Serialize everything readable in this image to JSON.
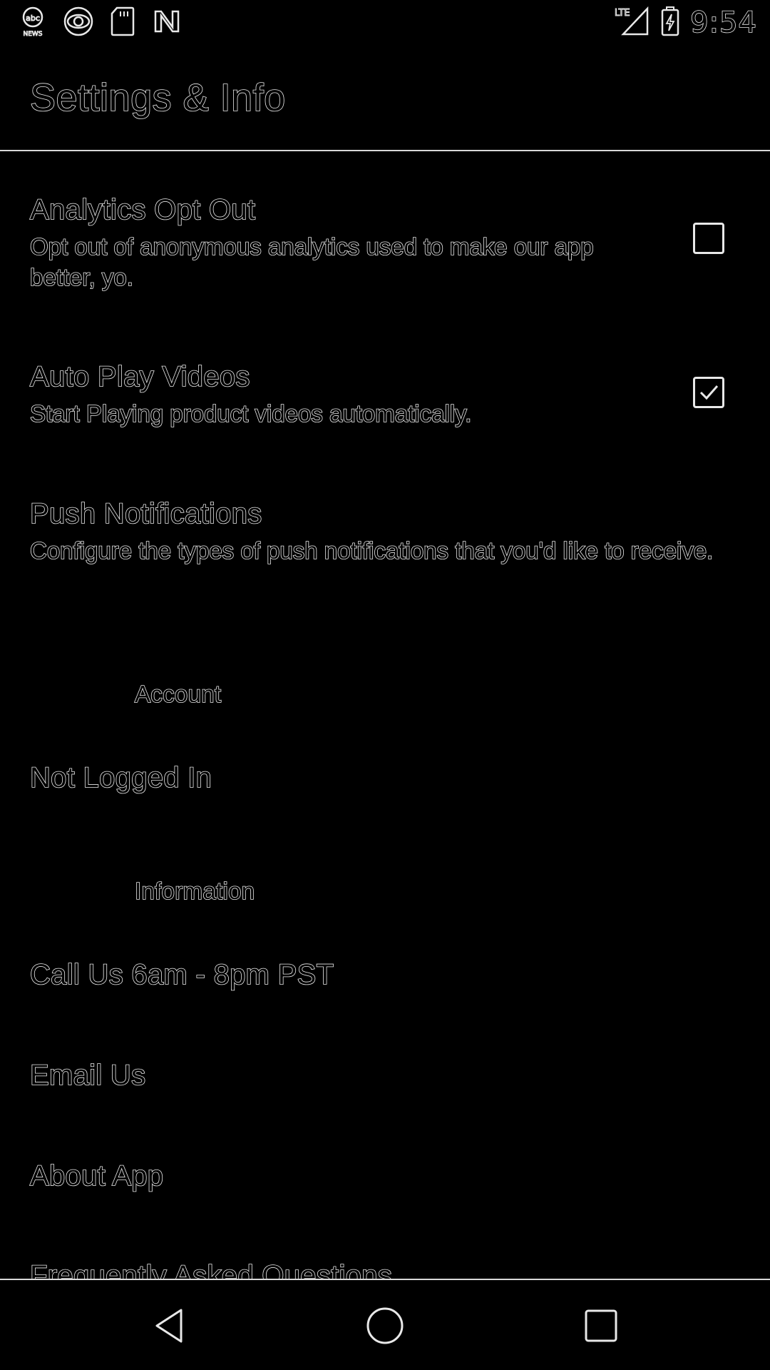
{
  "status_bar": {
    "time": "9:54",
    "notification_icons": [
      "abc-news-icon",
      "cbs-icon",
      "sd-card-icon",
      "n-app-icon"
    ],
    "network_label": "LTE",
    "battery_state": "charging"
  },
  "app_bar": {
    "title": "Settings & Info"
  },
  "preferences": [
    {
      "title": "Analytics Opt Out",
      "summary": "Opt out of anonymous analytics used to make our app better, yo.",
      "has_checkbox": true,
      "checked": false
    },
    {
      "title": "Auto Play Videos",
      "summary": "Start Playing product videos automatically.",
      "has_checkbox": true,
      "checked": true
    },
    {
      "title": "Push Notifications",
      "summary": "Configure the types of push notifications that you'd like to receive.",
      "has_checkbox": false
    }
  ],
  "account_section": {
    "header": "Account",
    "status": "Not Logged In"
  },
  "information_section": {
    "header": "Information",
    "items": [
      "Call Us 6am - 8pm PST",
      "Email Us",
      "About App",
      "Frequently Asked Questions"
    ]
  },
  "nav_bar": {
    "buttons": [
      "back-icon",
      "home-icon",
      "recents-icon"
    ]
  }
}
